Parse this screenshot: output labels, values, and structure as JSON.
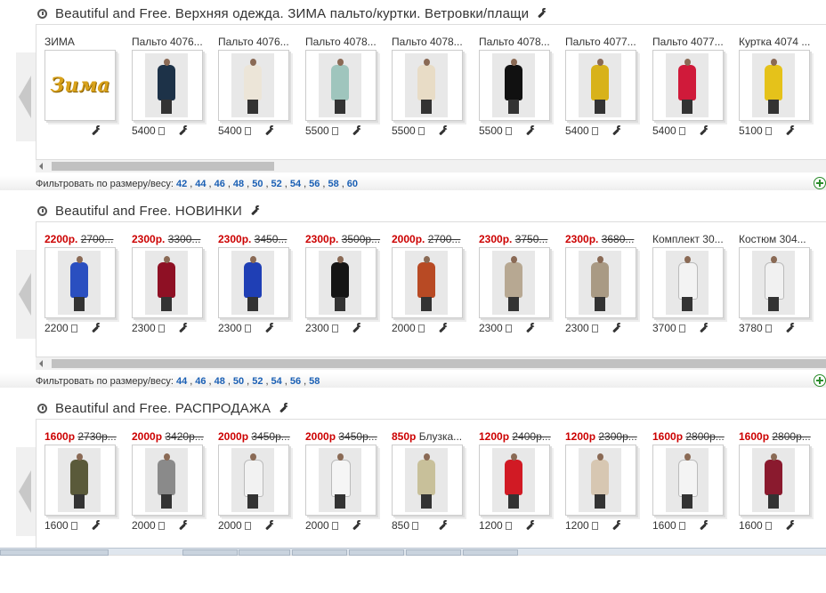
{
  "sections": [
    {
      "title": "Beautiful and Free. Верхняя одежда. ЗИМА пальто/куртки. Ветровки/плащи",
      "filter_label": "Фильтровать по размеру/весу:",
      "sizes": [
        "42",
        "44",
        "46",
        "48",
        "50",
        "52",
        "54",
        "56",
        "58",
        "60"
      ],
      "items": [
        {
          "name": "ЗИМА",
          "price": "",
          "special": "zima",
          "logo_text": "Зима"
        },
        {
          "name": "Пальто 4076...",
          "price": "5400",
          "color": "#1d3248"
        },
        {
          "name": "Пальто 4076...",
          "price": "5400",
          "color": "#ece5d8"
        },
        {
          "name": "Пальто 4078...",
          "price": "5500",
          "color": "#9fc5bd"
        },
        {
          "name": "Пальто 4078...",
          "price": "5500",
          "color": "#e8dcc6"
        },
        {
          "name": "Пальто 4078...",
          "price": "5500",
          "color": "#111111"
        },
        {
          "name": "Пальто 4077...",
          "price": "5400",
          "color": "#d8b21a"
        },
        {
          "name": "Пальто 4077...",
          "price": "5400",
          "color": "#d01a3a"
        },
        {
          "name": "Куртка 4074 ...",
          "price": "5100",
          "color": "#e5c21a"
        }
      ]
    },
    {
      "title": "Beautiful and Free. НОВИНКИ",
      "filter_label": "Фильтровать по размеру/весу:",
      "sizes": [
        "44",
        "46",
        "48",
        "50",
        "52",
        "54",
        "56",
        "58"
      ],
      "items": [
        {
          "new_price": "2200р.",
          "old_price": "2700...",
          "price": "2200",
          "color": "#2a4fc0"
        },
        {
          "new_price": "2300р.",
          "old_price": "3300...",
          "price": "2300",
          "color": "#8e1024"
        },
        {
          "new_price": "2300р.",
          "old_price": "3450...",
          "price": "2300",
          "color": "#1f3fb5"
        },
        {
          "new_price": "2300р.",
          "old_price": "3500р...",
          "price": "2300",
          "color": "#151515"
        },
        {
          "new_price": "2000р.",
          "old_price": "2700...",
          "price": "2000",
          "color": "#b84a24"
        },
        {
          "new_price": "2300р.",
          "old_price": "3750...",
          "price": "2300",
          "color": "#b7a892"
        },
        {
          "new_price": "2300р.",
          "old_price": "3680...",
          "price": "2300",
          "color": "#a99a84"
        },
        {
          "name": "Комплект 30...",
          "price": "3700",
          "color": "#f3f3f3"
        },
        {
          "name": "Костюм 304...",
          "price": "3780",
          "color": "#f1f1f1"
        }
      ]
    },
    {
      "title": "Beautiful and Free. РАСПРОДАЖА",
      "items": [
        {
          "new_price": "1600р",
          "old_price": "2730р...",
          "price": "1600",
          "color": "#5a5a3a"
        },
        {
          "new_price": "2000р",
          "old_price": "3420р...",
          "price": "2000",
          "color": "#8a8a8a"
        },
        {
          "new_price": "2000р",
          "old_price": "3450р...",
          "price": "2000",
          "color": "#f2f2f2"
        },
        {
          "new_price": "2000р",
          "old_price": "3450р...",
          "price": "2000",
          "color": "#f5f5f5"
        },
        {
          "new_price": "850р",
          "old_price": "",
          "name_tail": "Блузка...",
          "price": "850",
          "color": "#c8c09a"
        },
        {
          "new_price": "1200р",
          "old_price": "2400р...",
          "price": "1200",
          "color": "#d11a24"
        },
        {
          "new_price": "1200р",
          "old_price": "2300р...",
          "price": "1200",
          "color": "#d7c7b2"
        },
        {
          "new_price": "1600р",
          "old_price": "2800р...",
          "price": "1600",
          "color": "#f4f4f4"
        },
        {
          "new_price": "1600р",
          "old_price": "2800р...",
          "price": "1600",
          "color": "#8a1a2e"
        }
      ]
    }
  ]
}
